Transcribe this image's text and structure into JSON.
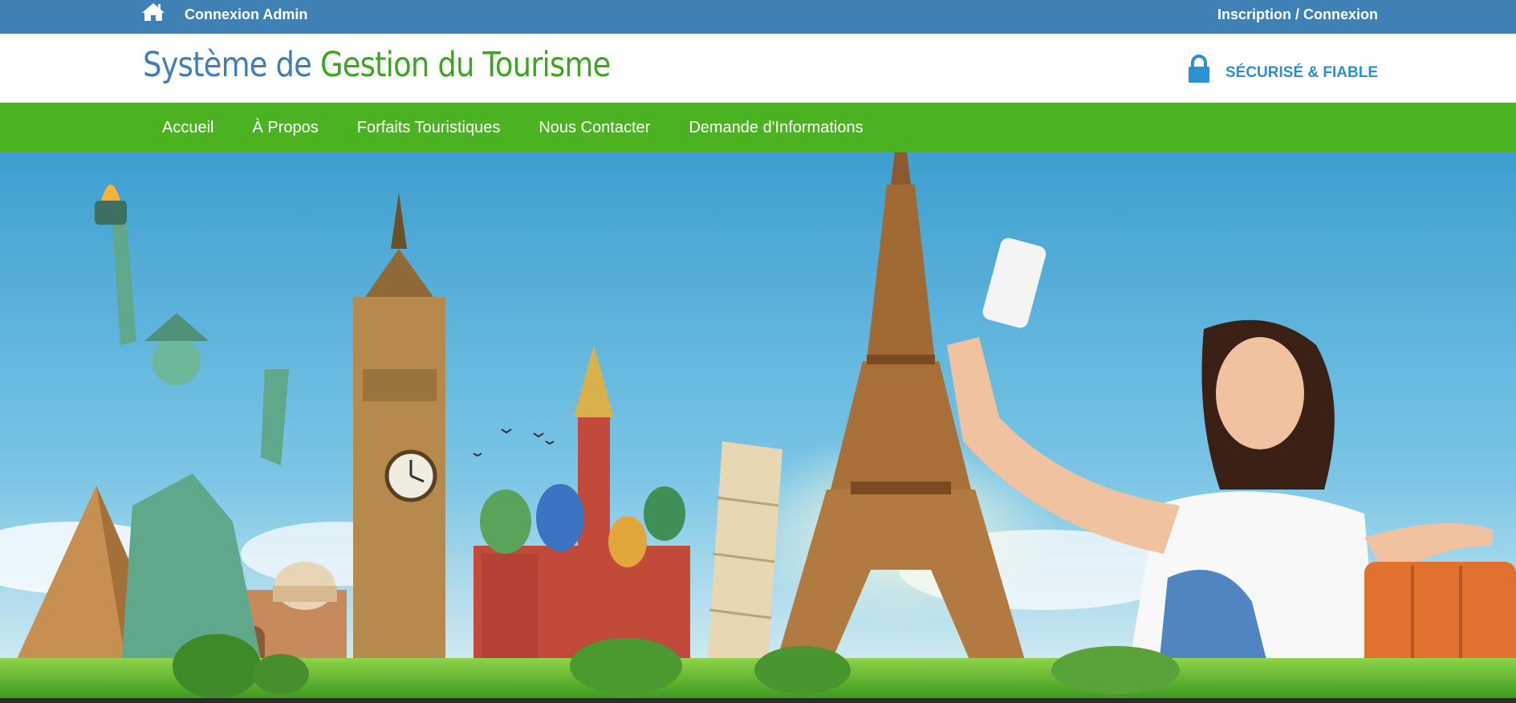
{
  "topbar": {
    "home_icon": "home-icon",
    "admin_label": "Connexion Admin",
    "auth_label": "Inscription / Connexion"
  },
  "header": {
    "title_part1": "Système de",
    "title_part2": "Gestion du Tourisme",
    "secure_icon": "lock-icon",
    "secure_label": "SÉCURISÉ & FIABLE"
  },
  "nav": {
    "items": [
      {
        "label": "Accueil"
      },
      {
        "label": "À Propos"
      },
      {
        "label": "Forfaits Touristiques"
      },
      {
        "label": "Nous Contacter"
      },
      {
        "label": "Demande d'Informations"
      }
    ]
  },
  "hero": {
    "image": "world-landmarks-selfie-banner"
  },
  "colors": {
    "topbar_bg": "#3f81b4",
    "title_blue": "#3f7fb3",
    "title_green": "#3ea524",
    "nav_bg": "#4bb322",
    "secure_blue": "#2d8fd0"
  }
}
